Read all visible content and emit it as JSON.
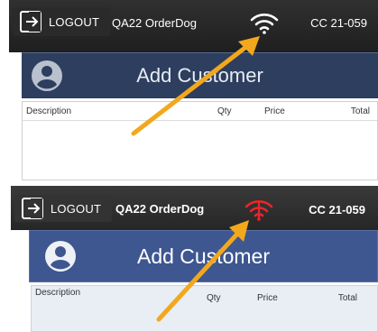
{
  "screens": [
    {
      "logout_label": "LOGOUT",
      "store_name": "QA22 OrderDog",
      "register_id": "CC 21-059",
      "wifi_status_color": "#ffffff",
      "header_title": "Add Customer",
      "columns": {
        "description": "Description",
        "qty": "Qty",
        "price": "Price",
        "total": "Total"
      }
    },
    {
      "logout_label": "LOGOUT",
      "store_name": "QA22 OrderDog",
      "register_id": "CC 21-059",
      "wifi_status_color": "#e8262b",
      "header_title": "Add Customer",
      "columns": {
        "description": "Description",
        "qty": "Qty",
        "price": "Price",
        "total": "Total"
      }
    }
  ],
  "colors": {
    "arrow": "#f2a81d",
    "header_band": "#2d3e5e",
    "topbar": "#262626"
  },
  "icons": [
    "logout-icon",
    "wifi-icon",
    "avatar-icon",
    "arrow-annotation"
  ]
}
